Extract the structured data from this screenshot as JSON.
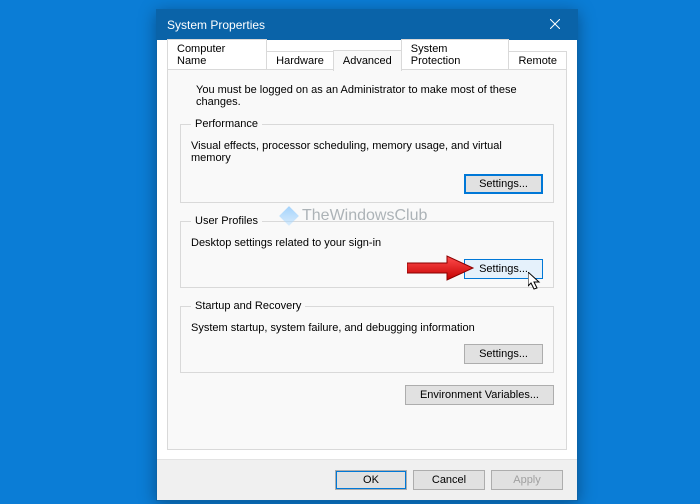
{
  "window": {
    "title": "System Properties"
  },
  "tabs": [
    {
      "label": "Computer Name"
    },
    {
      "label": "Hardware"
    },
    {
      "label": "Advanced"
    },
    {
      "label": "System Protection"
    },
    {
      "label": "Remote"
    }
  ],
  "advanced": {
    "note": "You must be logged on as an Administrator to make most of these changes.",
    "performance": {
      "legend": "Performance",
      "desc": "Visual effects, processor scheduling, memory usage, and virtual memory",
      "button": "Settings..."
    },
    "userprofiles": {
      "legend": "User Profiles",
      "desc": "Desktop settings related to your sign-in",
      "button": "Settings..."
    },
    "startup": {
      "legend": "Startup and Recovery",
      "desc": "System startup, system failure, and debugging information",
      "button": "Settings..."
    },
    "env_button": "Environment Variables..."
  },
  "footer": {
    "ok": "OK",
    "cancel": "Cancel",
    "apply": "Apply"
  },
  "watermark": "TheWindowsClub"
}
